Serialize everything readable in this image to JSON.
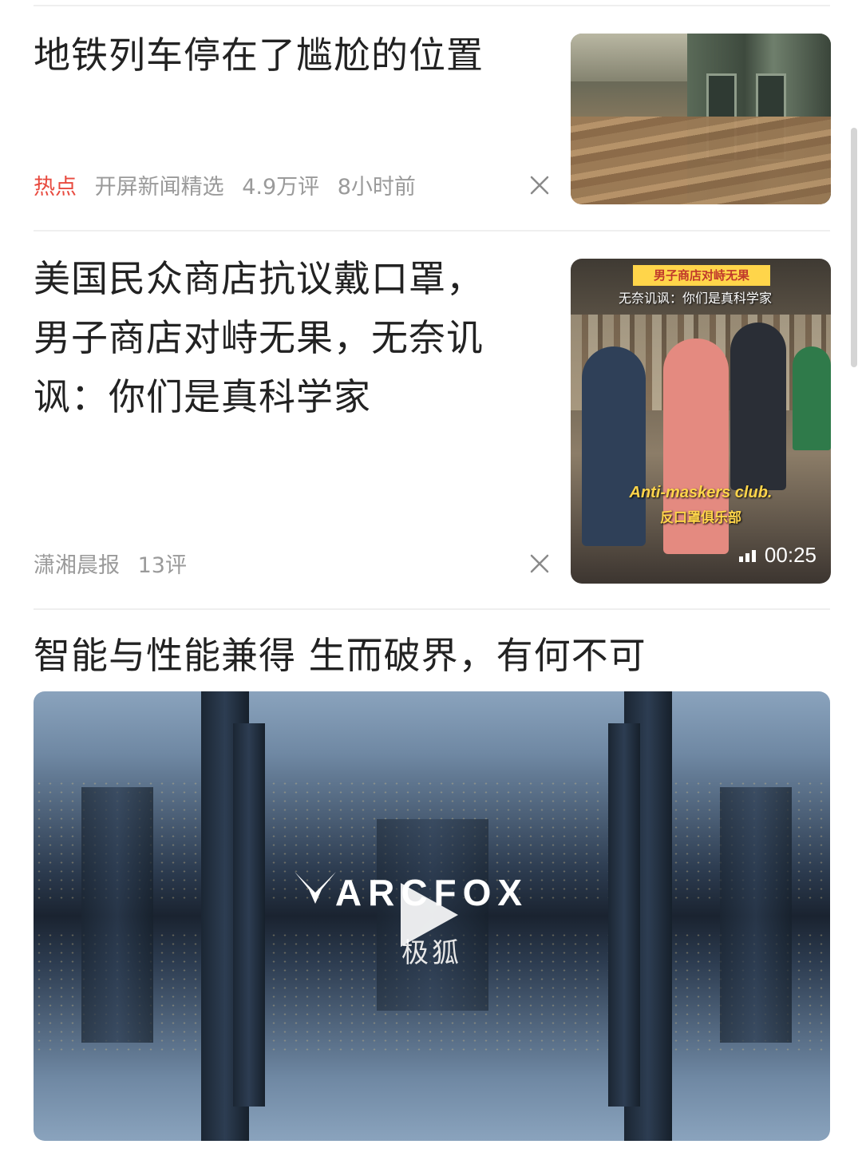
{
  "feed": {
    "items": [
      {
        "headline": "地铁列车停在了尴尬的位置",
        "tag": "热点",
        "source": "开屏新闻精选",
        "comments": "4.9万评",
        "time": "8小时前"
      },
      {
        "headline": "美国民众商店抗议戴口罩，男子商店对峙无果，无奈讥讽：你们是真科学家",
        "source": "潇湘晨报",
        "comments": "13评",
        "thumb_banner": "男子商店对峙无果",
        "thumb_subtitle": "无奈讥讽：你们是真科学家",
        "thumb_caption_en": "Anti-maskers club.",
        "thumb_caption_zh": "反口罩俱乐部",
        "duration": "00:25"
      }
    ],
    "ad": {
      "title": "智能与性能兼得 生而破界，有何不可",
      "brand": "ARCFOX",
      "brand_cn": "极狐"
    }
  },
  "icons": {
    "close": "close-icon",
    "play": "play-icon",
    "duration": "signal-bars-icon"
  },
  "colors": {
    "hot_tag": "#e84a3f",
    "meta_text": "#9a9a9a",
    "headline_text": "#222222"
  }
}
